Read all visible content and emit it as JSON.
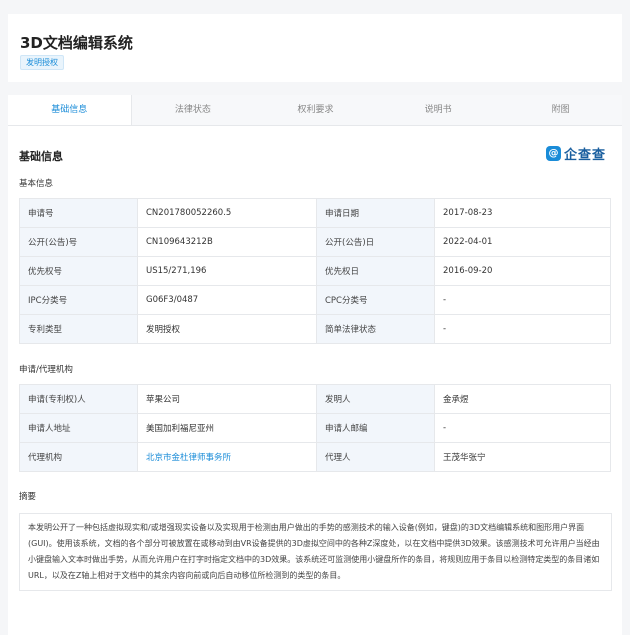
{
  "header": {
    "title": "3D文档编辑系统",
    "badge": "发明授权"
  },
  "tabs": [
    {
      "label": "基础信息",
      "active": true
    },
    {
      "label": "法律状态",
      "active": false
    },
    {
      "label": "权利要求",
      "active": false
    },
    {
      "label": "说明书",
      "active": false
    },
    {
      "label": "附图",
      "active": false
    }
  ],
  "section": {
    "title": "基础信息",
    "logo_mark": "@",
    "logo_text": "企查查"
  },
  "basic": {
    "title": "基本信息",
    "rows": [
      {
        "k1": "申请号",
        "v1": "CN201780052260.5",
        "k2": "申请日期",
        "v2": "2017-08-23"
      },
      {
        "k1": "公开(公告)号",
        "v1": "CN109643212B",
        "k2": "公开(公告)日",
        "v2": "2022-04-01"
      },
      {
        "k1": "优先权号",
        "v1": "US15/271,196",
        "k2": "优先权日",
        "v2": "2016-09-20"
      },
      {
        "k1": "IPC分类号",
        "v1": "G06F3/0487",
        "k2": "CPC分类号",
        "v2": "-"
      },
      {
        "k1": "专利类型",
        "v1": "发明授权",
        "k2": "简单法律状态",
        "v2": "-"
      }
    ]
  },
  "agency": {
    "title": "申请/代理机构",
    "rows": [
      {
        "k1": "申请(专利权)人",
        "v1": "苹果公司",
        "k2": "发明人",
        "v2": "金承煜"
      },
      {
        "k1": "申请人地址",
        "v1": "美国加利福尼亚州",
        "k2": "申请人邮编",
        "v2": "-"
      },
      {
        "k1": "代理机构",
        "v1": "北京市金杜律师事务所",
        "k2": "代理人",
        "v2": "王茂华张宁"
      }
    ]
  },
  "abstract": {
    "title": "摘要",
    "text": "本发明公开了一种包括虚拟现实和/或增强现实设备以及实现用于检测由用户做出的手势的感测技术的输入设备(例如，键盘)的3D文档编辑系统和图形用户界面(GUI)。使用该系统，文档的各个部分可被放置在或移动到由VR设备提供的3D虚拟空间中的各种Z深度处，以在文档中提供3D效果。该感测技术可允许用户当经由小键盘输入文本时做出手势，从而允许用户在打字时指定文档中的3D效果。该系统还可监测使用小键盘所作的条目，将规则应用于条目以检测特定类型的条目诸如URL，以及在Z轴上相对于文档中的其余内容向前或向后自动移位所检测到的类型的条目。"
  },
  "colors": {
    "accent": "#1a8cd8",
    "key_cell_bg": "#f2f6fb",
    "border": "#e6e8eb"
  }
}
